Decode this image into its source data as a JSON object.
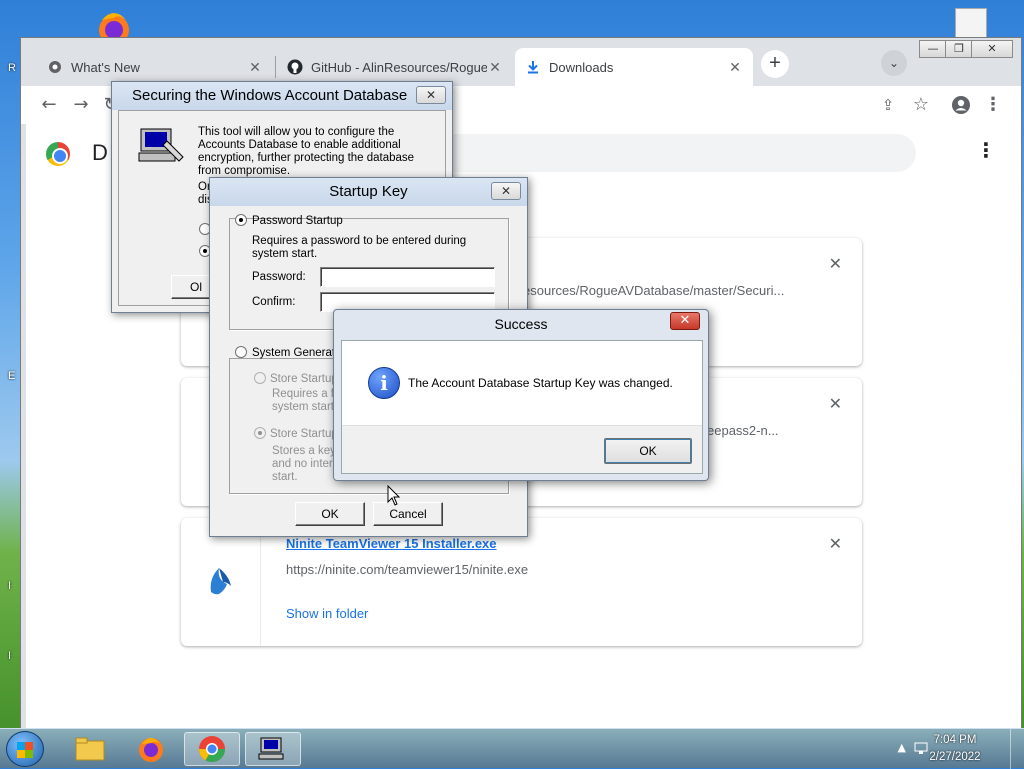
{
  "browser": {
    "tabs": [
      {
        "title": "What's New",
        "icon": "chrome-icon"
      },
      {
        "title": "GitHub - AlinResources/RogueAV",
        "icon": "github-icon"
      },
      {
        "title": "Downloads",
        "icon": "download-icon"
      }
    ],
    "active_tab": 2
  },
  "downloads_page": {
    "title_partial": "D",
    "items": [
      {
        "url_partial": "esources/RogueAVDatabase/master/Securi..."
      },
      {
        "url_partial": "eepass2-n..."
      },
      {
        "name": "Ninite TeamViewer 15 Installer.exe",
        "url": "https://ninite.com/teamviewer15/ninite.exe",
        "action": "Show in folder"
      }
    ]
  },
  "syskey_dialog": {
    "title": "Securing the Windows Account Database",
    "description": "This tool will allow you to configure the Accounts Database to enable additional encryption, further protecting the database from compromise.",
    "partial_text_1": "Or",
    "partial_text_2": "dis",
    "ok_partial": "Ol"
  },
  "startup_key_dialog": {
    "title": "Startup Key",
    "password_startup": "Password Startup",
    "password_startup_desc": "Requires a password to be entered during system start.",
    "password_label": "Password:",
    "confirm_label": "Confirm:",
    "system_generated": "System Generated",
    "store_local_partial": "Store Startup",
    "store_local_desc_1": "Requires a fl",
    "store_local_desc_2": "system start.",
    "store_floppy_partial": "Store Startup",
    "store_floppy_desc_1": "Stores a key",
    "store_floppy_desc_2": "and no intera",
    "store_floppy_desc_3": "start.",
    "ok": "OK",
    "cancel": "Cancel"
  },
  "success_dialog": {
    "title": "Success",
    "message": "The Account Database Startup Key was changed.",
    "ok": "OK"
  },
  "taskbar": {
    "time": "7:04 PM",
    "date": "2/27/2022"
  },
  "desktop": {
    "edge_letters": [
      "R",
      "E",
      "I",
      "I"
    ]
  }
}
